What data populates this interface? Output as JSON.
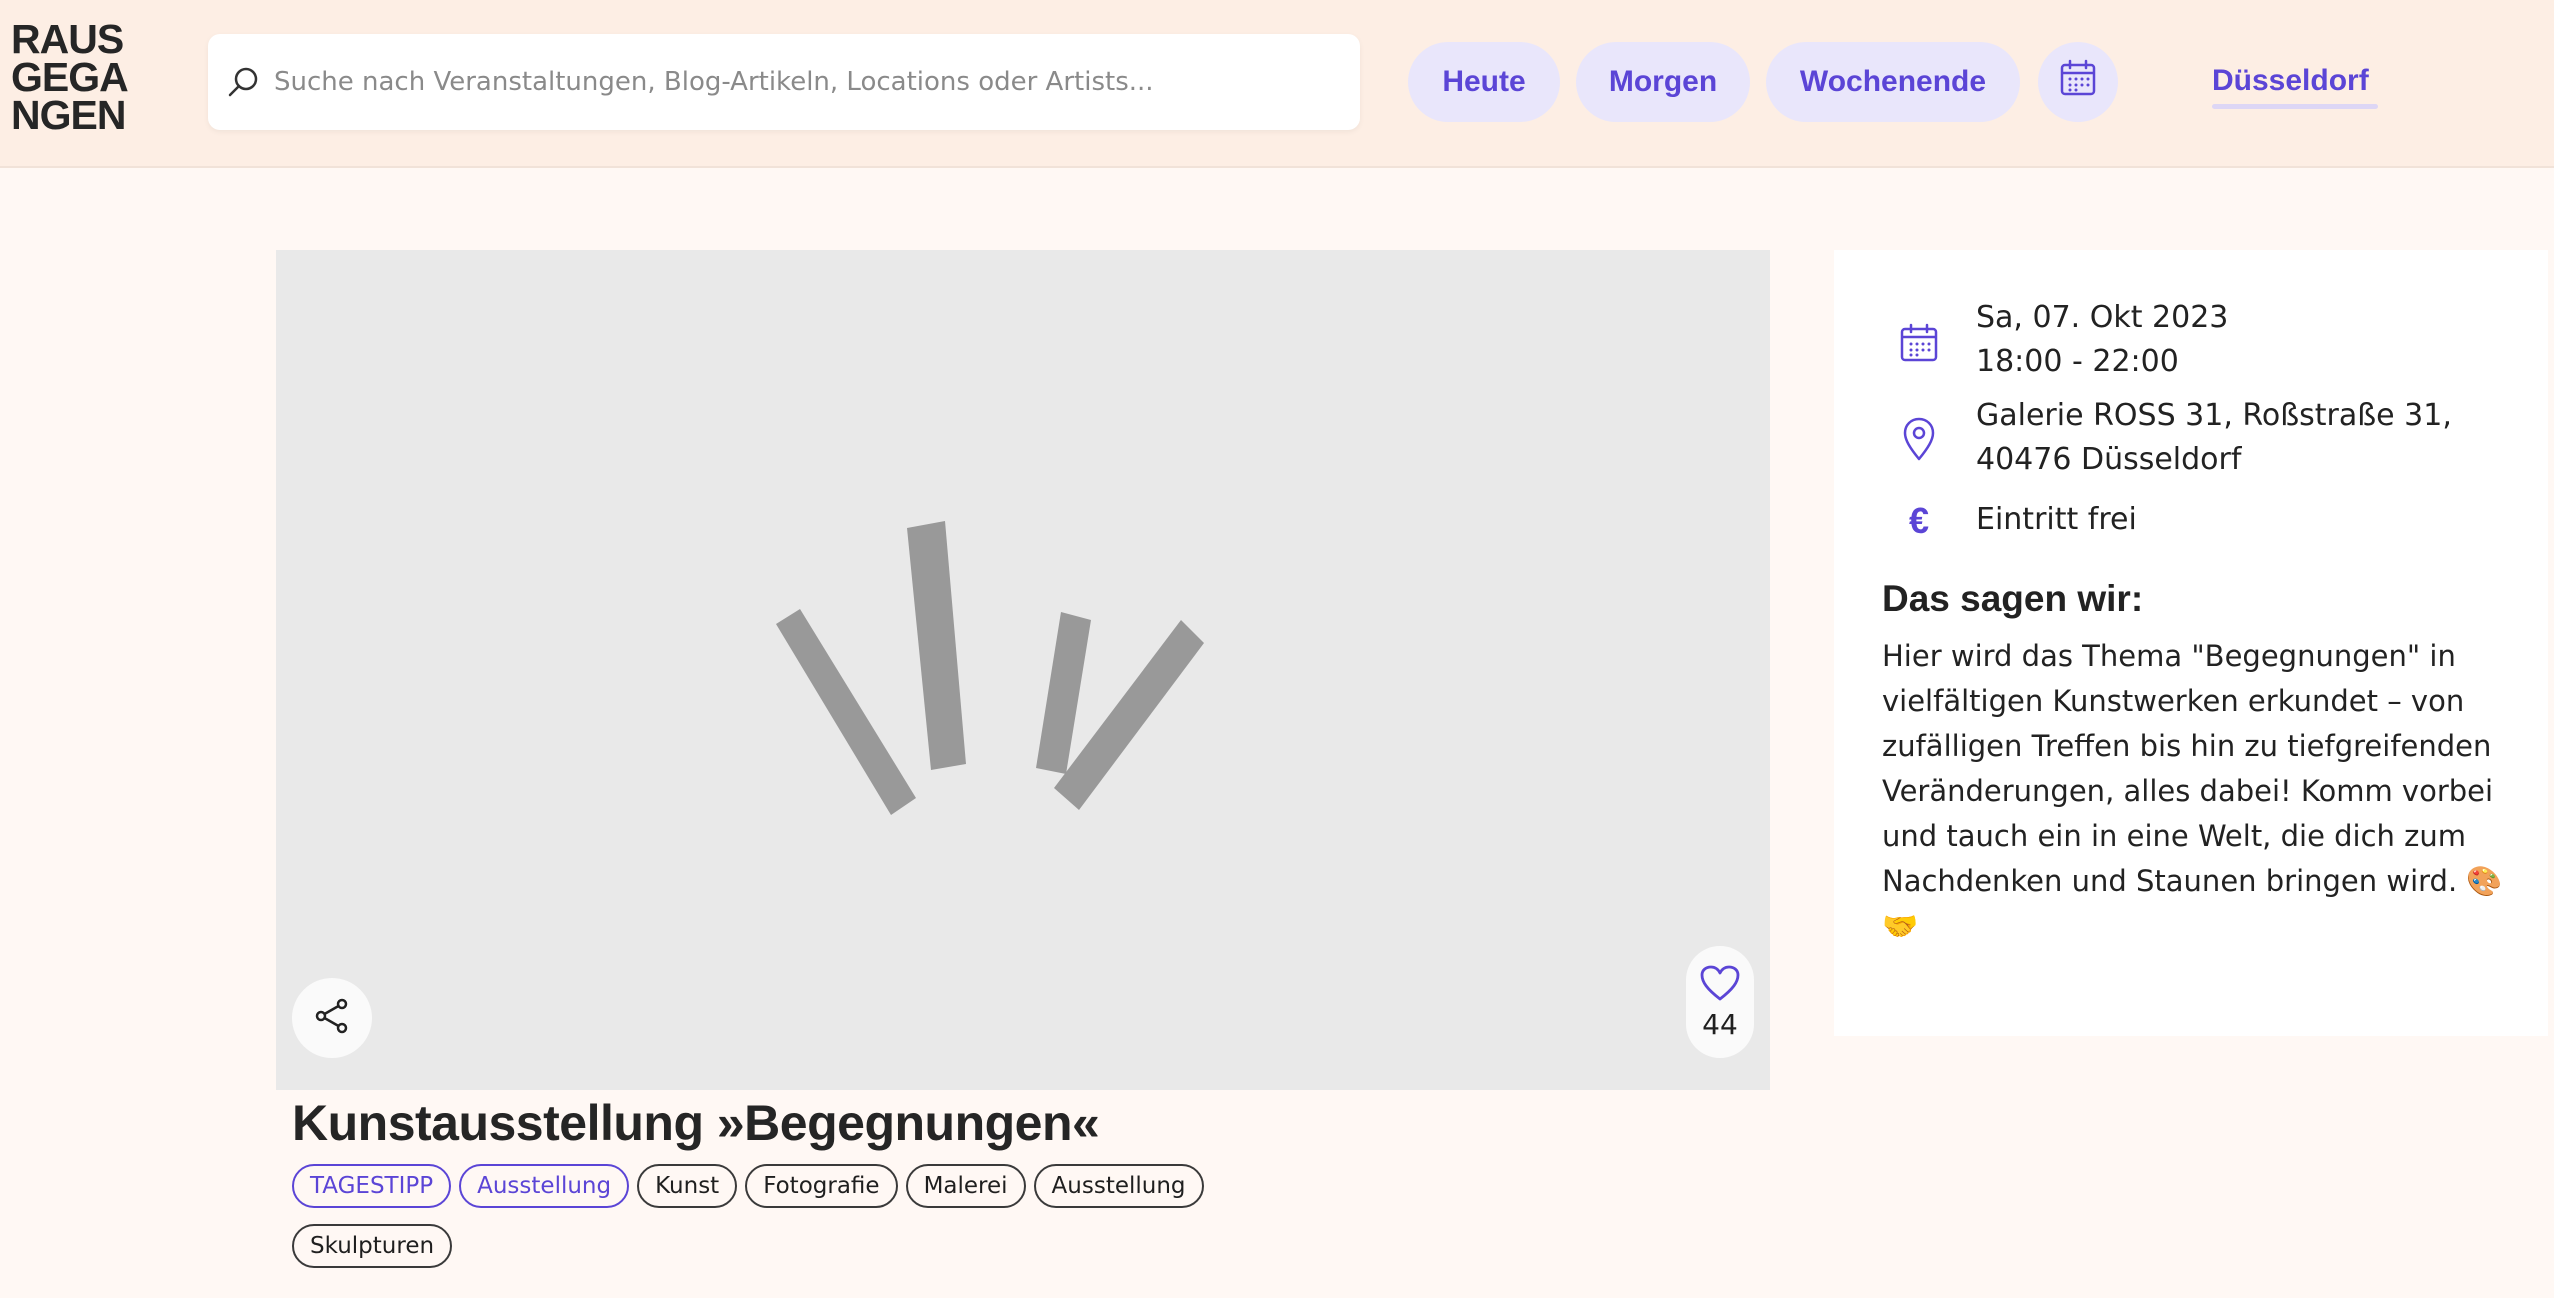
{
  "header": {
    "logo_lines": [
      "RAUS",
      "GEGA",
      "NGEN"
    ],
    "search_placeholder": "Suche nach Veranstaltungen, Blog-Artikeln, Locations oder Artists...",
    "quick_filters": [
      "Heute",
      "Morgen",
      "Wochenende"
    ],
    "calendar_icon": "calendar-icon",
    "city": "Düsseldorf"
  },
  "event": {
    "title": "Kunstausstellung »Begegnungen«",
    "likes": "44",
    "tags": [
      "TAGESTIPP",
      "Ausstellung",
      "Kunst",
      "Fotografie",
      "Malerei",
      "Ausstellung",
      "Skulpturen"
    ]
  },
  "info": {
    "date": "Sa, 07. Okt 2023",
    "time": "18:00 - 22:00",
    "address_line1": "Galerie ROSS 31, Roßstraße 31,",
    "address_line2": "40476 Düsseldorf",
    "price": "Eintritt frei",
    "sagen_title": "Das sagen wir:",
    "sagen_text": "Hier wird das Thema \"Begegnungen\" in vielfältigen Kunstwerken erkundet – von zufälligen Treffen bis hin zu tiefgreifenden Veränderungen, alles dabei! Komm vorbei und tauch ein in eine Welt, die dich zum Nachdenken und Staunen bringen wird. 🎨🤝"
  },
  "colors": {
    "accent": "#5b45d6",
    "header_bg": "#fdeee4",
    "page_bg": "#fff8f4",
    "pill_bg": "#e9e6fb"
  }
}
